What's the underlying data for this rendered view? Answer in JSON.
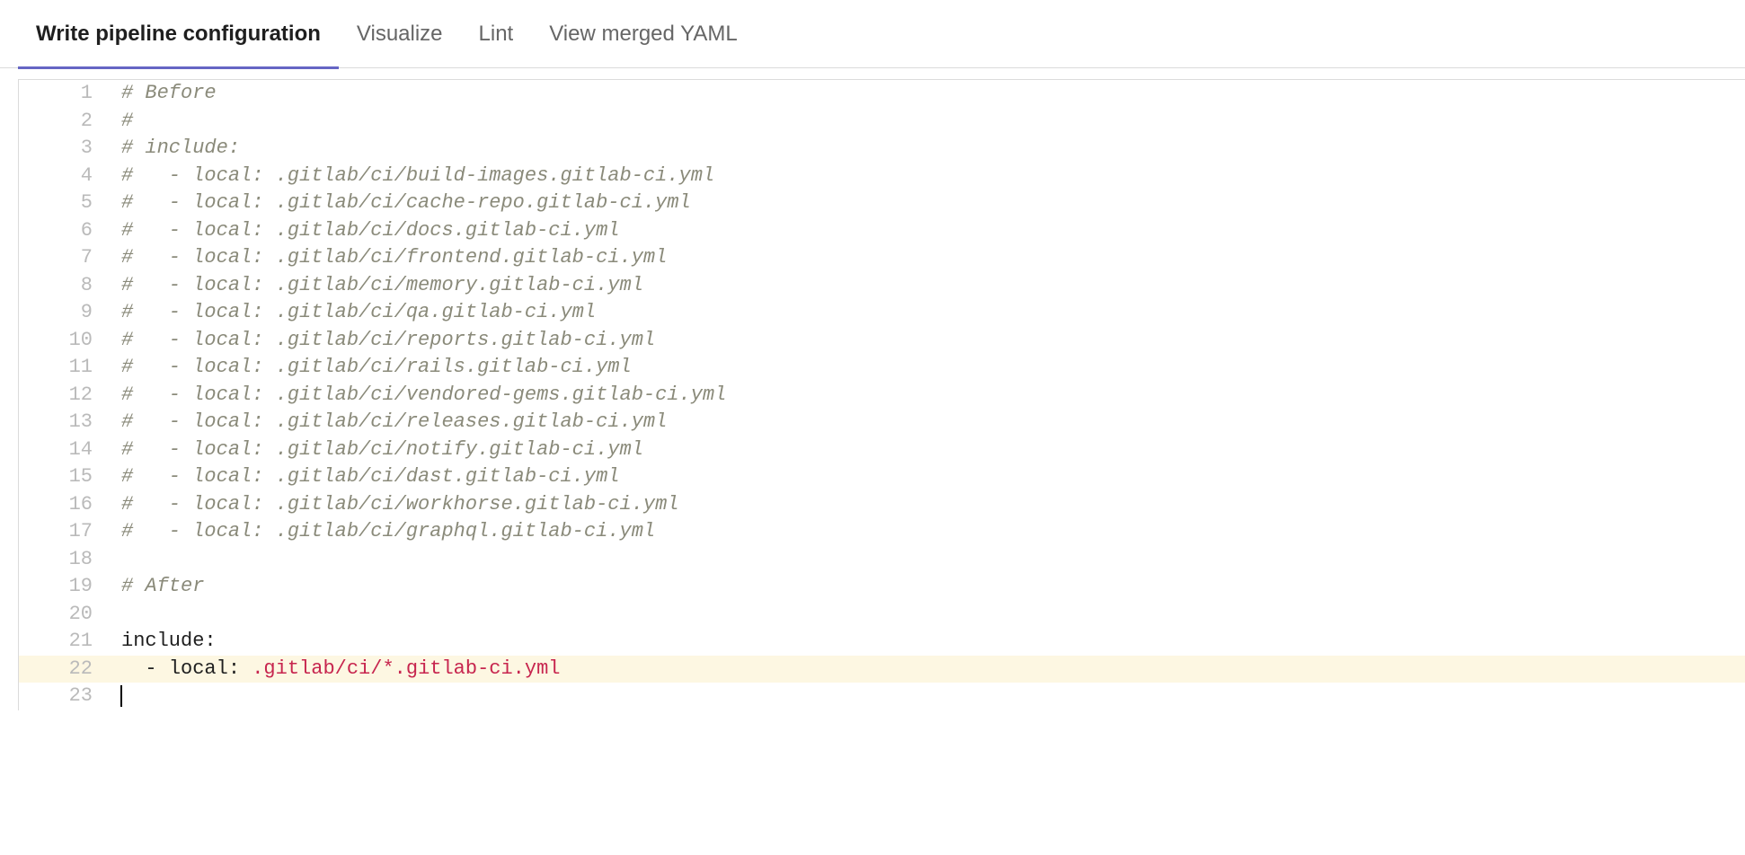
{
  "tabs": [
    {
      "label": "Write pipeline configuration",
      "active": true
    },
    {
      "label": "Visualize",
      "active": false
    },
    {
      "label": "Lint",
      "active": false
    },
    {
      "label": "View merged YAML",
      "active": false
    }
  ],
  "editor": {
    "lines": [
      {
        "n": 1,
        "t": "comment",
        "text": "# Before"
      },
      {
        "n": 2,
        "t": "comment",
        "text": "#"
      },
      {
        "n": 3,
        "t": "comment",
        "text": "# include:"
      },
      {
        "n": 4,
        "t": "comment",
        "text": "#   - local: .gitlab/ci/build-images.gitlab-ci.yml"
      },
      {
        "n": 5,
        "t": "comment",
        "text": "#   - local: .gitlab/ci/cache-repo.gitlab-ci.yml"
      },
      {
        "n": 6,
        "t": "comment",
        "text": "#   - local: .gitlab/ci/docs.gitlab-ci.yml"
      },
      {
        "n": 7,
        "t": "comment",
        "text": "#   - local: .gitlab/ci/frontend.gitlab-ci.yml"
      },
      {
        "n": 8,
        "t": "comment",
        "text": "#   - local: .gitlab/ci/memory.gitlab-ci.yml"
      },
      {
        "n": 9,
        "t": "comment",
        "text": "#   - local: .gitlab/ci/qa.gitlab-ci.yml"
      },
      {
        "n": 10,
        "t": "comment",
        "text": "#   - local: .gitlab/ci/reports.gitlab-ci.yml"
      },
      {
        "n": 11,
        "t": "comment",
        "text": "#   - local: .gitlab/ci/rails.gitlab-ci.yml"
      },
      {
        "n": 12,
        "t": "comment",
        "text": "#   - local: .gitlab/ci/vendored-gems.gitlab-ci.yml"
      },
      {
        "n": 13,
        "t": "comment",
        "text": "#   - local: .gitlab/ci/releases.gitlab-ci.yml"
      },
      {
        "n": 14,
        "t": "comment",
        "text": "#   - local: .gitlab/ci/notify.gitlab-ci.yml"
      },
      {
        "n": 15,
        "t": "comment",
        "text": "#   - local: .gitlab/ci/dast.gitlab-ci.yml"
      },
      {
        "n": 16,
        "t": "comment",
        "text": "#   - local: .gitlab/ci/workhorse.gitlab-ci.yml"
      },
      {
        "n": 17,
        "t": "comment",
        "text": "#   - local: .gitlab/ci/graphql.gitlab-ci.yml"
      },
      {
        "n": 18,
        "t": "blank",
        "text": ""
      },
      {
        "n": 19,
        "t": "comment",
        "text": "# After"
      },
      {
        "n": 20,
        "t": "blank",
        "text": ""
      },
      {
        "n": 21,
        "t": "key",
        "key": "include",
        "colon": ":"
      },
      {
        "n": 22,
        "t": "item",
        "indent": "  - ",
        "key": "local",
        "colon": ": ",
        "value": ".gitlab/ci/*.gitlab-ci.yml",
        "highlight": true
      },
      {
        "n": 23,
        "t": "blank",
        "text": "",
        "cursor": true
      }
    ]
  }
}
